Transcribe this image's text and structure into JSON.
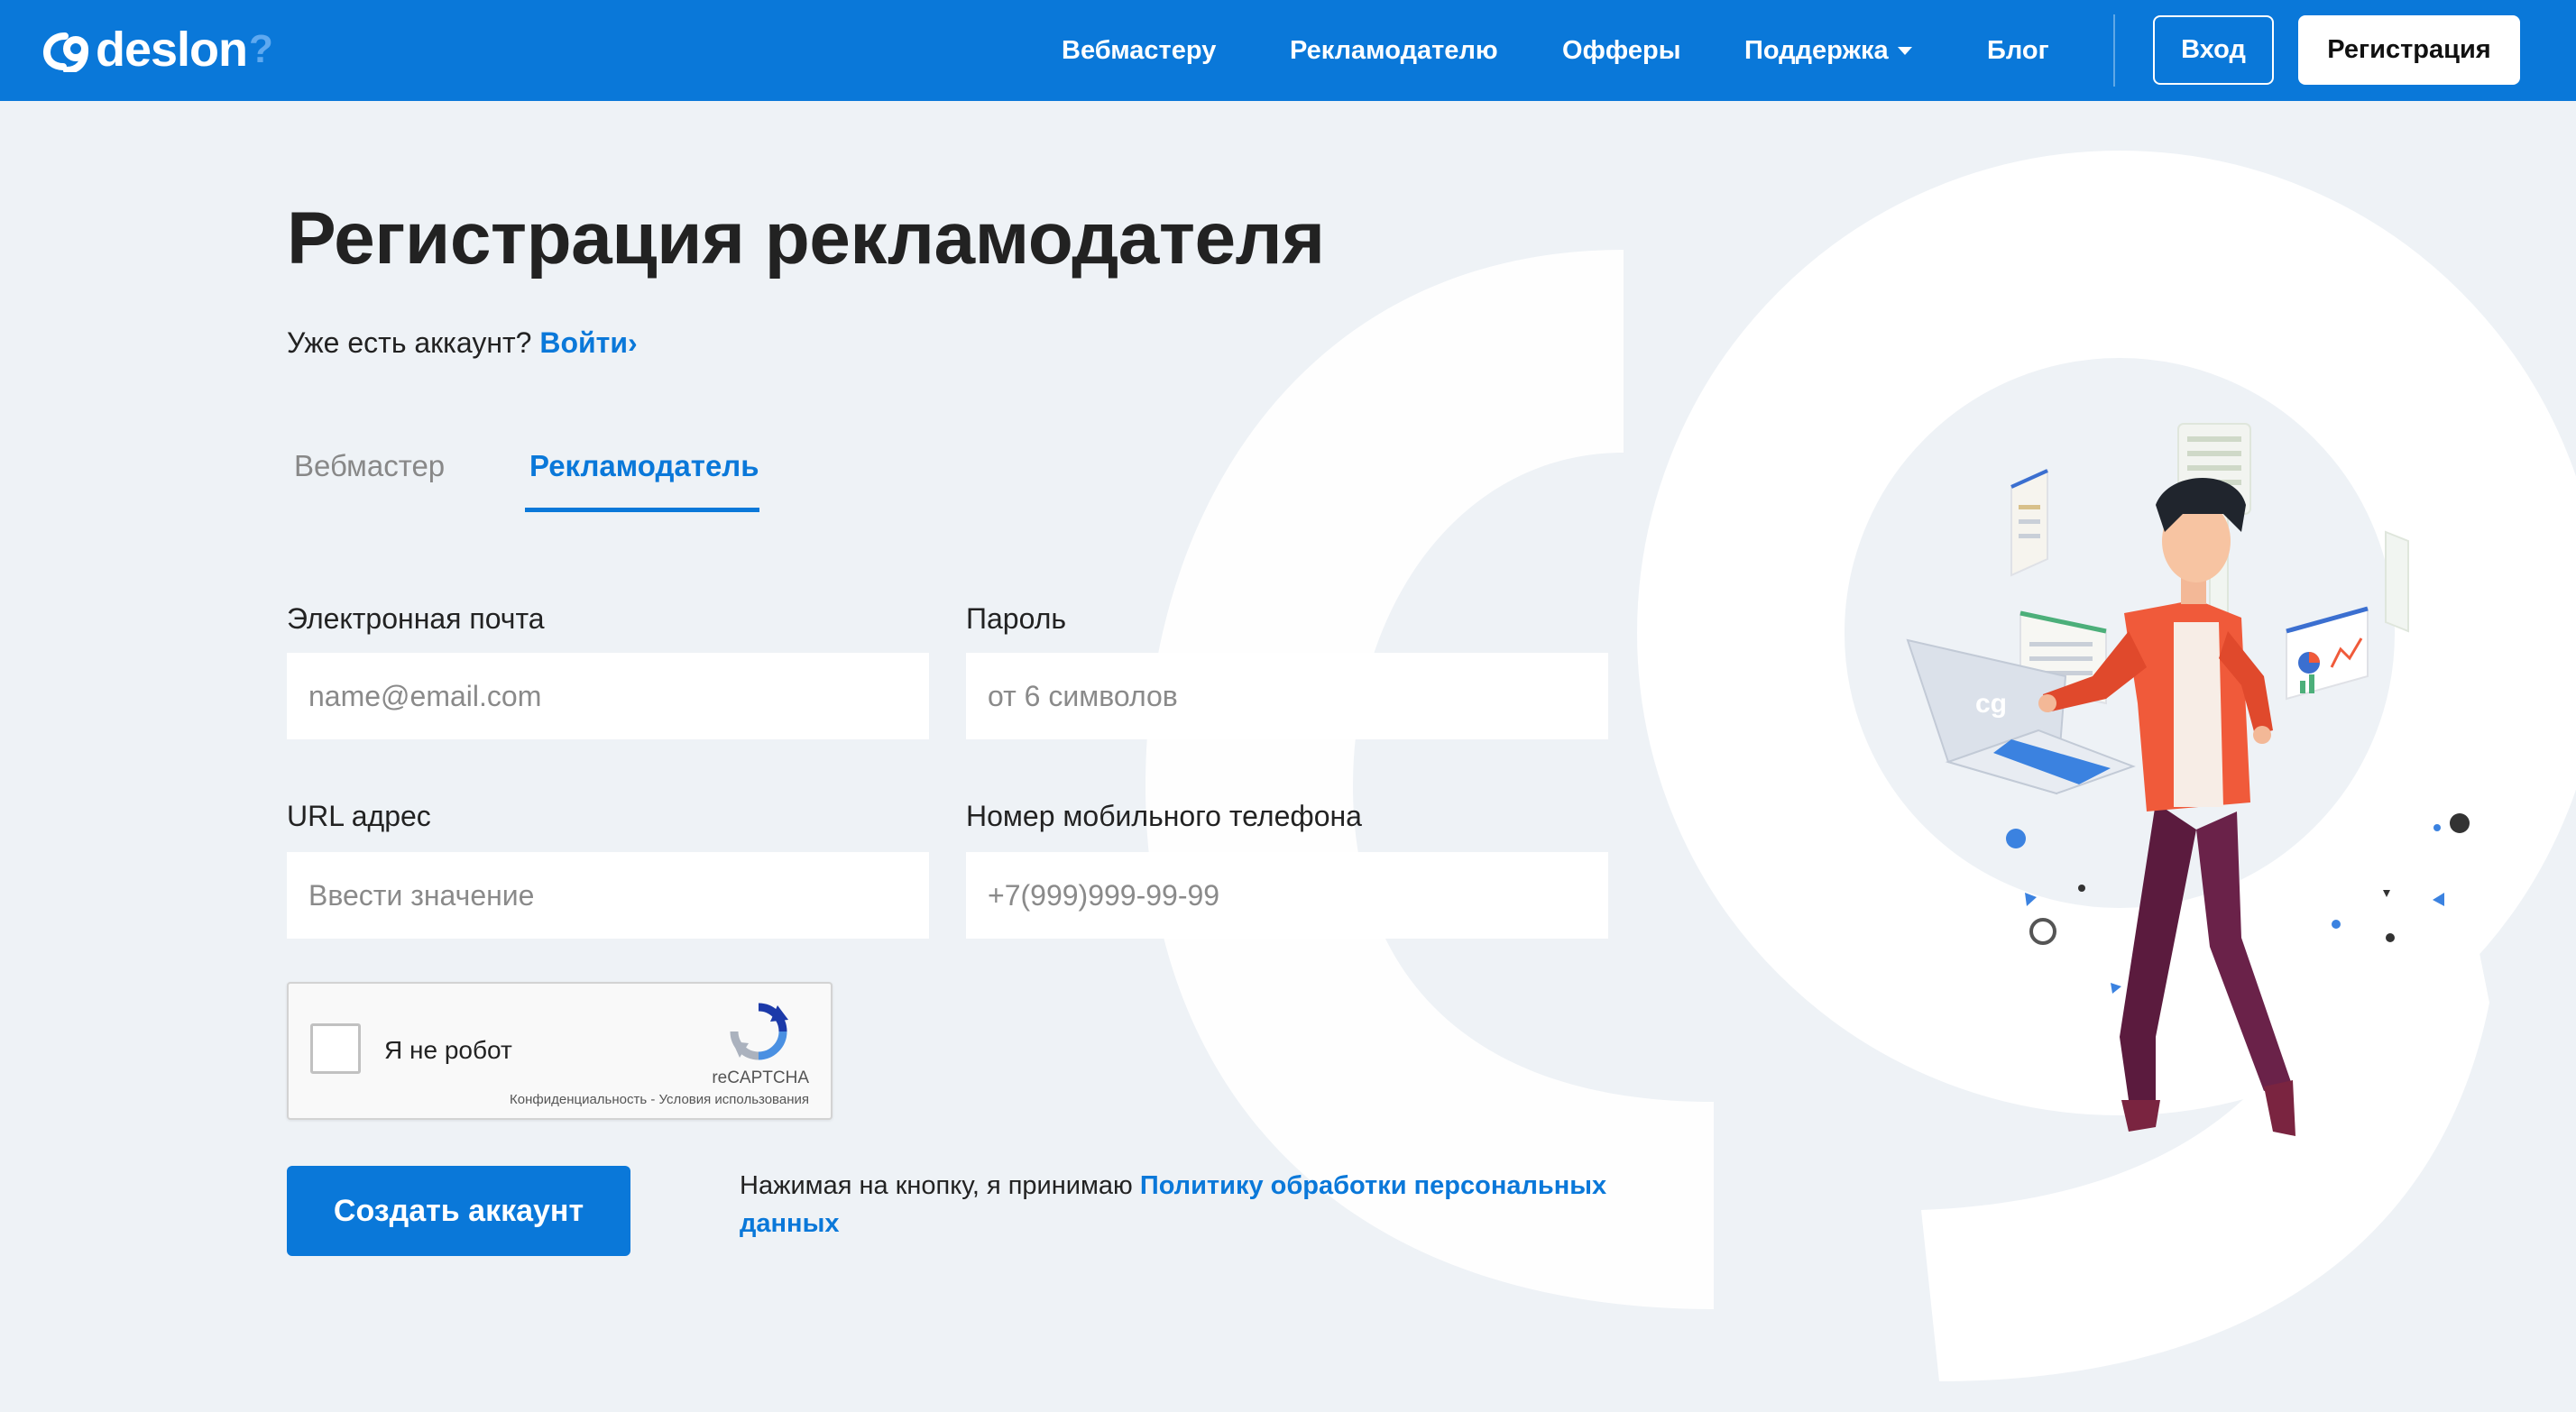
{
  "header": {
    "logo_text": "deslon",
    "logo_suffix": "?",
    "nav": [
      "Вебмастеру",
      "Рекламодателю",
      "Офферы",
      "Поддержка",
      "Блог"
    ],
    "login_label": "Вход",
    "register_label": "Регистрация"
  },
  "page": {
    "title": "Регистрация рекламодателя",
    "have_account_text": "Уже есть аккаунт? ",
    "login_link": "Войти›"
  },
  "tabs": {
    "webmaster": "Вебмастер",
    "advertiser": "Рекламодатель",
    "active": "advertiser"
  },
  "form": {
    "email": {
      "label": "Электронная почта",
      "placeholder": "name@email.com",
      "value": ""
    },
    "password": {
      "label": "Пароль",
      "placeholder": "от 6 символов",
      "value": ""
    },
    "url": {
      "label": "URL адрес",
      "placeholder": "Ввести значение",
      "value": ""
    },
    "phone": {
      "label": "Номер мобильного телефона",
      "placeholder": "+7(999)999-99-99",
      "value": ""
    }
  },
  "captcha": {
    "label": "Я не робот",
    "brand": "reCAPTCHA",
    "terms": "Конфиденциальность - Условия использования",
    "checked": false
  },
  "submit": {
    "label": "Создать аккаунт",
    "consent_text": "Нажимая на кнопку, я принимаю ",
    "consent_link": "Политику обработки персональных данных"
  },
  "colors": {
    "brand_blue": "#0a78d9",
    "page_bg": "#eef2f6",
    "accent_orange": "#f05a3a",
    "pants_purple": "#5b1b3e"
  },
  "icons": [
    "logo-mark-icon",
    "chevron-down-icon",
    "recaptcha-icon",
    "user-illustration"
  ]
}
